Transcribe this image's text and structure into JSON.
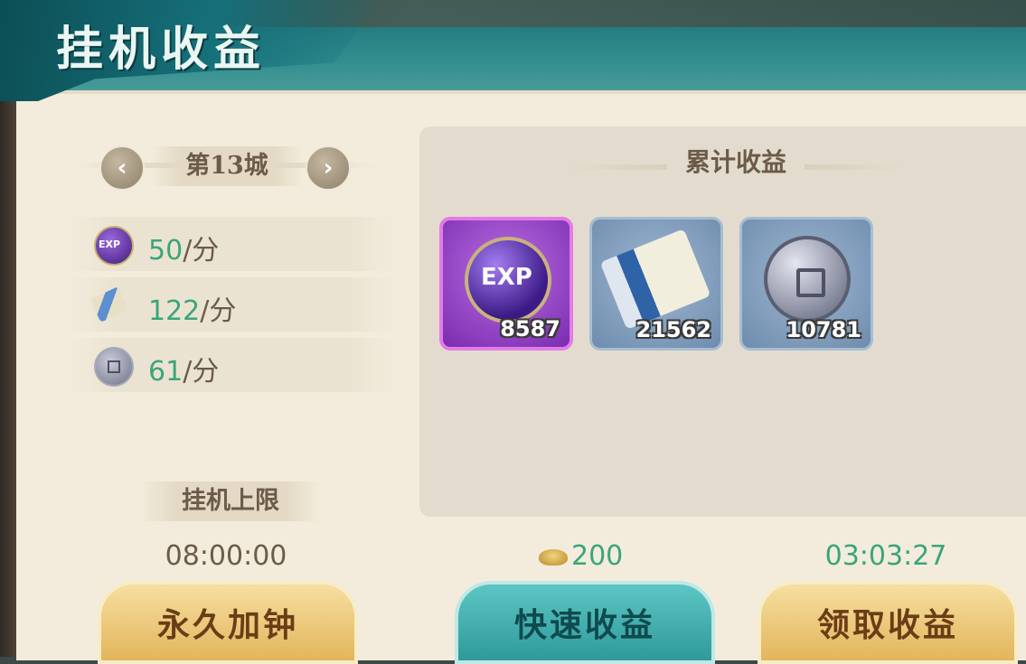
{
  "header": {
    "title": "挂机收益"
  },
  "city": {
    "name": "第13城",
    "prev_icon": "chevron-left-icon",
    "next_icon": "chevron-right-icon"
  },
  "rates": [
    {
      "icon": "exp-orb-icon",
      "value": "50",
      "unit": "/分"
    },
    {
      "icon": "scroll-icon",
      "value": "122",
      "unit": "/分"
    },
    {
      "icon": "coin-icon",
      "value": "61",
      "unit": "/分"
    }
  ],
  "limit": {
    "label": "挂机上限",
    "value": "08:00:00"
  },
  "rewards": {
    "header": "累计收益",
    "items": [
      {
        "name": "exp",
        "icon": "exp-orb-icon",
        "count": "8587"
      },
      {
        "name": "scroll",
        "icon": "scroll-icon",
        "count": "21562"
      },
      {
        "name": "coin",
        "icon": "coin-icon",
        "count": "10781"
      }
    ]
  },
  "quick": {
    "cost": "200",
    "cost_icon": "gold-ingot-icon"
  },
  "claim": {
    "timer": "03:03:27"
  },
  "buttons": {
    "extend": "永久加钟",
    "quick": "快速收益",
    "claim": "领取收益"
  },
  "colors": {
    "accent_green": "#3aa57a",
    "teal": "#2f9a9a",
    "gold": "#e3b55c",
    "exp_purple": "#7a2bb0"
  }
}
